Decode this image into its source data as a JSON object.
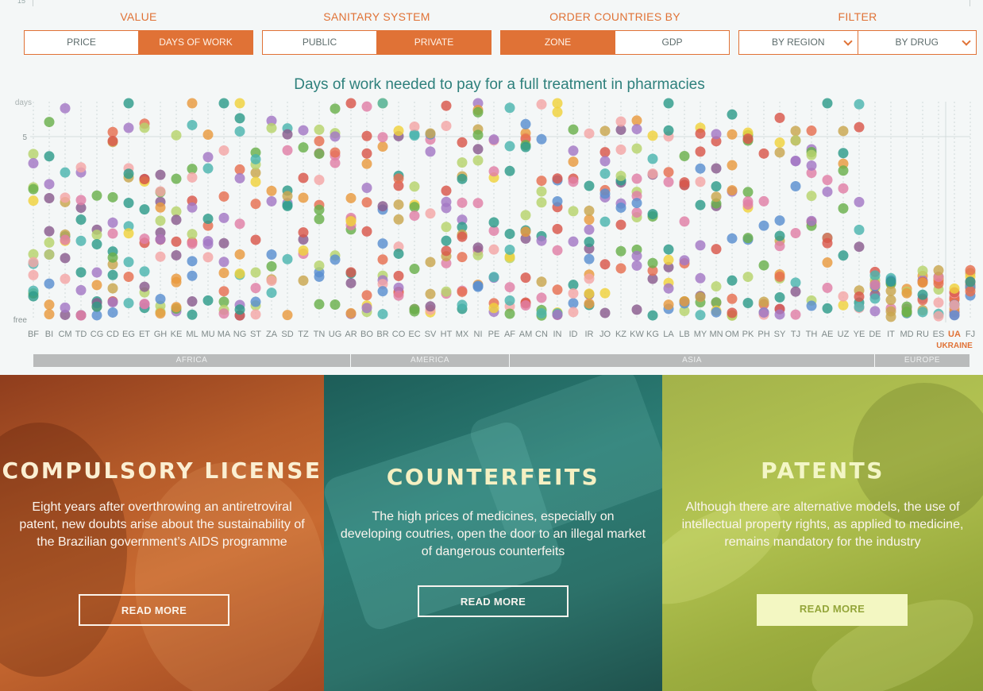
{
  "axis_top_label": "15",
  "controls": [
    {
      "title": "VALUE",
      "options": [
        "PRICE",
        "DAYS OF WORK"
      ],
      "active": 1
    },
    {
      "title": "SANITARY SYSTEM",
      "options": [
        "PUBLIC",
        "PRIVATE"
      ],
      "active": 1
    },
    {
      "title": "ORDER COUNTRIES BY",
      "options": [
        "ZONE",
        "GDP"
      ],
      "active": 0
    },
    {
      "title": "FILTER",
      "options": [
        "BY REGION",
        "BY DRUG"
      ],
      "active": -1
    }
  ],
  "chart_title": "Days of work needed to pay for a full treatment in pharmacies",
  "chart_data": {
    "type": "scatter",
    "title": "Days of work needed to pay for a full treatment in pharmacies",
    "y_tick_labels": [
      "free",
      "5"
    ],
    "y_top_label": "days",
    "ylim": [
      0,
      6
    ],
    "categories": [
      "BF",
      "BI",
      "CM",
      "TD",
      "CG",
      "CD",
      "EG",
      "ET",
      "GH",
      "KE",
      "ML",
      "MU",
      "MA",
      "NG",
      "ST",
      "ZA",
      "SD",
      "TZ",
      "TN",
      "UG",
      "AR",
      "BO",
      "BR",
      "CO",
      "EC",
      "SV",
      "HT",
      "MX",
      "NI",
      "PE",
      "AF",
      "AM",
      "CN",
      "IN",
      "ID",
      "IR",
      "JO",
      "KZ",
      "KW",
      "KG",
      "LA",
      "LB",
      "MY",
      "MN",
      "OM",
      "PK",
      "PH",
      "SY",
      "TJ",
      "TH",
      "AE",
      "UZ",
      "YE",
      "DE",
      "IT",
      "MD",
      "RU",
      "ES",
      "UA",
      "FJ"
    ],
    "highlighted": {
      "code": "UA",
      "name": "UKRAINE"
    },
    "regions": [
      {
        "name": "AFRICA",
        "from": "BF",
        "to": "UG"
      },
      {
        "name": "AMERICA",
        "from": "AR",
        "to": "PE"
      },
      {
        "name": "ASIA",
        "from": "AF",
        "to": "YE"
      },
      {
        "name": "EUROPE",
        "from": "DE",
        "to": "FJ"
      }
    ],
    "dot_colors": [
      "#d9574a",
      "#e99a3e",
      "#f0d23c",
      "#6ab04c",
      "#2e9b8a",
      "#5a8fd0",
      "#a477c4",
      "#e07fa6",
      "#c9a64e",
      "#8a5c8e",
      "#e76f51",
      "#b7d36b",
      "#4cb5ae",
      "#f4a6a6"
    ],
    "grid": true,
    "legend": "none"
  },
  "cards": [
    {
      "title": "COMPULSORY LICENSE",
      "text": "Eight years after overthrowing an antiretroviral patent, new doubts arise about the sustainability of the Brazilian government’s AIDS programme",
      "button": "READ MORE"
    },
    {
      "title": "COUNTERFEITS",
      "text": "The high prices of medicines, especially on developing coutries, open the door to an illegal market of dangerous counterfeits",
      "button": "READ MORE"
    },
    {
      "title": "PATENTS",
      "text": "Although there are alternative models, the use of intellectual property rights, as applied to medicine, remains mandatory for the industry",
      "button": "READ MORE"
    }
  ]
}
